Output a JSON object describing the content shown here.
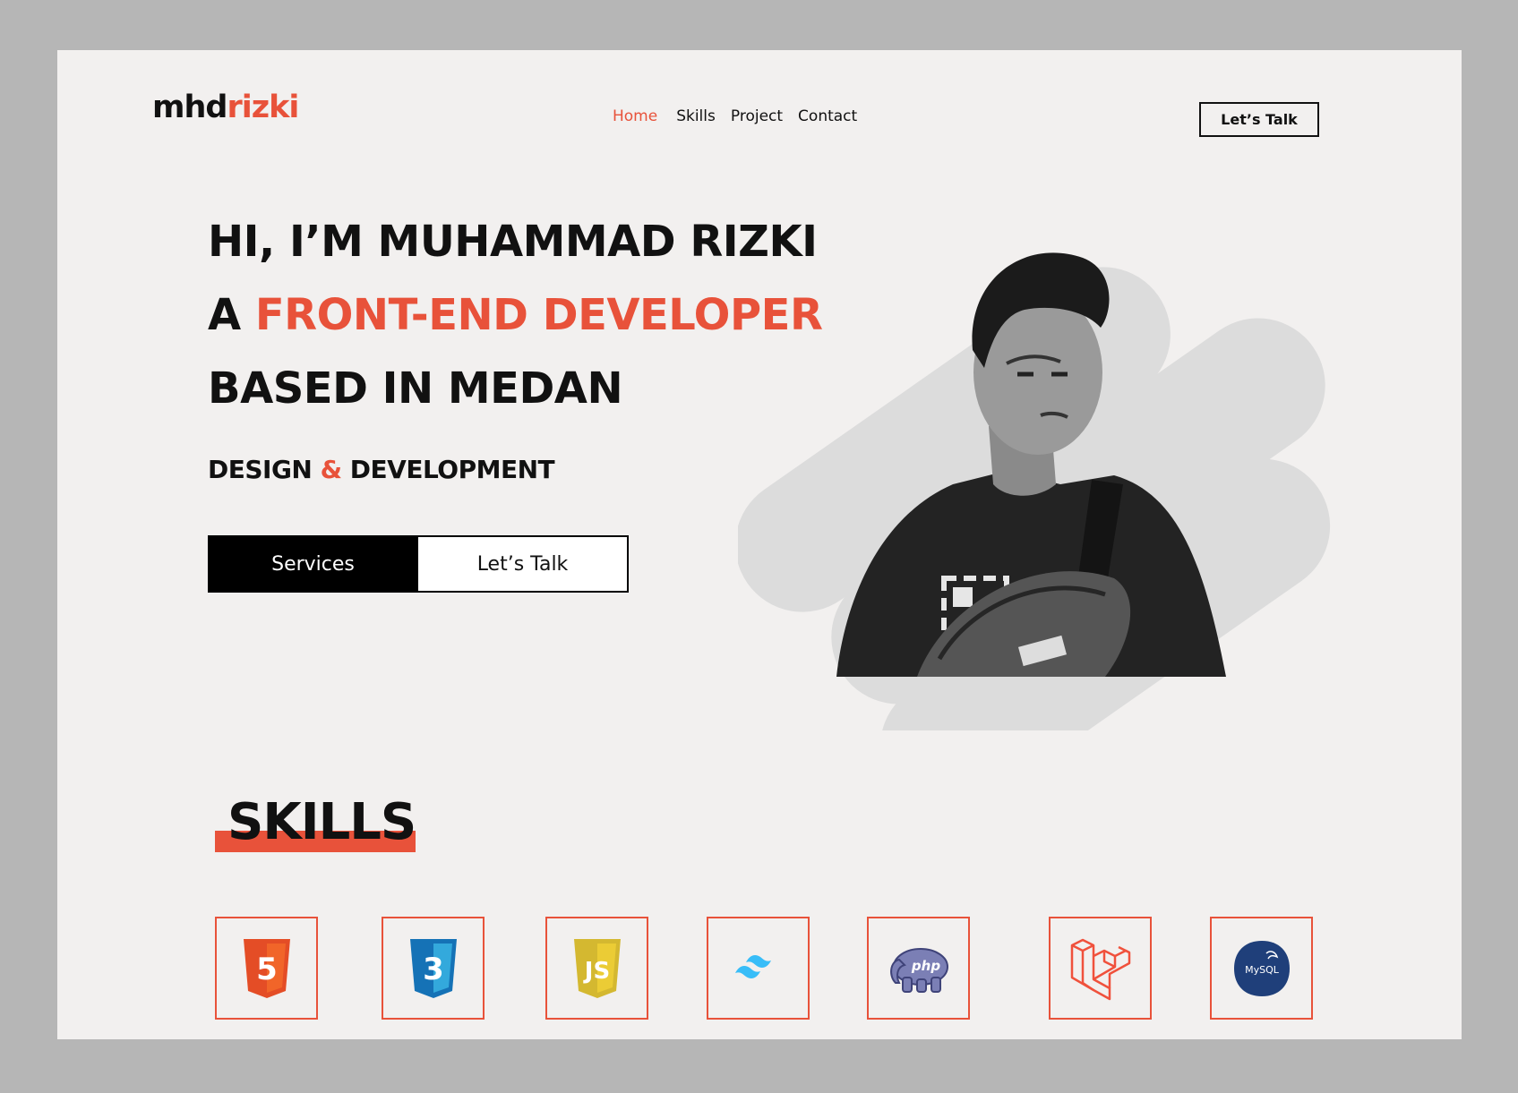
{
  "brand": {
    "logo_primary": "mhd",
    "logo_accent": "rizki",
    "accent_color": "#e8523a"
  },
  "nav": {
    "items": [
      {
        "label": "Home",
        "active": true
      },
      {
        "label": "Skills"
      },
      {
        "label": "Project"
      },
      {
        "label": "Contact"
      }
    ]
  },
  "header": {
    "cta_label": "Let’s Talk"
  },
  "hero": {
    "line1": "HI, I’M MUHAMMAD RIZKI",
    "line2_prefix": "A",
    "line2_accent": "FRONT-END DEVELOPER",
    "line3": "BASED IN MEDAN",
    "tagline_left": "DESIGN",
    "tagline_amp": "&",
    "tagline_right": "DEVELOPMENT",
    "primary_button": "Services",
    "secondary_button": "Let’s Talk"
  },
  "skills": {
    "title": "SKILLS",
    "items": [
      {
        "icon": "html5-icon",
        "label": "5"
      },
      {
        "icon": "css3-icon",
        "label": "3"
      },
      {
        "icon": "javascript-icon",
        "label": "JS"
      },
      {
        "icon": "tailwind-icon"
      },
      {
        "icon": "php-icon",
        "label": "php"
      },
      {
        "icon": "laravel-icon"
      },
      {
        "icon": "mysql-icon",
        "label": "MySQL"
      }
    ]
  }
}
